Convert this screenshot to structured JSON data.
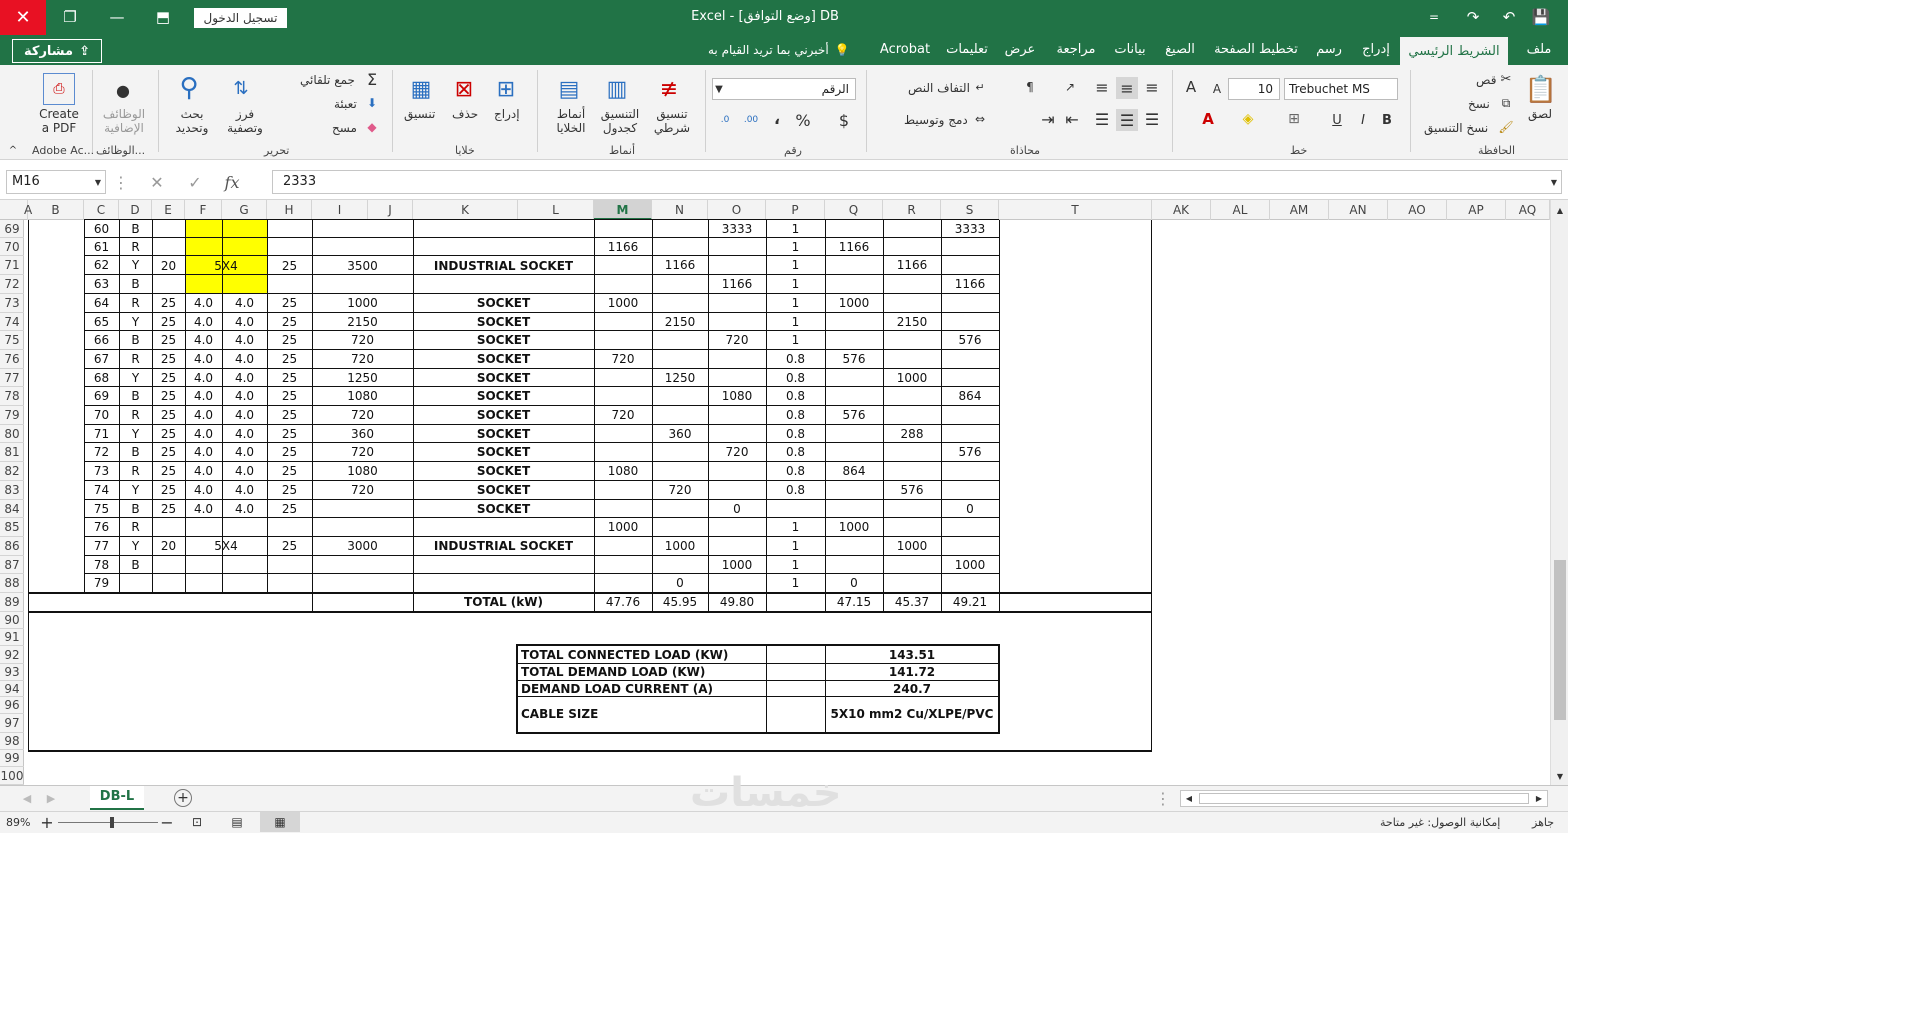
{
  "titlebar": {
    "app_name": "Excel",
    "title": "Excel  -  [وضع التوافق]  DB",
    "login_label": "تسجيل الدخول",
    "qat_dropdown": "="
  },
  "tabs": [
    "ملف",
    "الشريط الرئيسي",
    "إدراج",
    "رسم",
    "تخطيط الصفحة",
    "الصيغ",
    "بيانات",
    "مراجعة",
    "عرض",
    "تعليمات",
    "Acrobat"
  ],
  "tellme": "أخبرني بما تريد القيام به",
  "share_label": "مشاركة",
  "ribbon": {
    "clipboard": {
      "paste": "لصق",
      "cut": "قص",
      "copy": "نسخ",
      "format_painter": "نسخ التنسيق",
      "group": "الحافظة"
    },
    "font": {
      "name": "Trebuchet MS",
      "size": "10",
      "bold": "B",
      "italic": "I",
      "underline": "U",
      "group": "خط"
    },
    "alignment": {
      "wrap": "التفاف النص",
      "merge": "دمج وتوسيط",
      "group": "محاذاة"
    },
    "number": {
      "format": "الرقم",
      "currency": "$",
      "percent": "%",
      "comma": "،",
      "group": "رقم"
    },
    "styles": {
      "conditional": "تنسيق شرطي",
      "as_table": "التنسيق كجدول",
      "cell_styles": "أنماط الخلايا",
      "group": "أنماط"
    },
    "cells": {
      "insert": "إدراج",
      "delete": "حذف",
      "format": "تنسيق",
      "group": "خلايا"
    },
    "editing": {
      "autosum": "جمع تلقائي",
      "fill": "تعبئة",
      "clear": "مسح",
      "sort": "فرز وتصفية",
      "find": "بحث وتحديد",
      "group": "تحرير"
    },
    "addins": {
      "label": "الوظائف الإضافية",
      "group": "الوظائف..."
    },
    "adobe": {
      "create_pdf": "Create a PDF",
      "group": "Adobe Ac..."
    }
  },
  "formula_bar": {
    "name_box": "M16",
    "fx": "fx",
    "value": "2333"
  },
  "columns": [
    "A",
    "B",
    "C",
    "D",
    "E",
    "F",
    "G",
    "H",
    "I",
    "J",
    "K",
    "L",
    "M",
    "N",
    "O",
    "P",
    "Q",
    "R",
    "S",
    "T",
    "AK",
    "AL",
    "AM",
    "AN",
    "AO",
    "AP",
    "AQ"
  ],
  "selected_column": "M",
  "row_numbers": [
    "69",
    "70",
    "71",
    "72",
    "73",
    "74",
    "75",
    "76",
    "77",
    "78",
    "79",
    "80",
    "81",
    "82",
    "83",
    "84",
    "85",
    "86",
    "87",
    "88",
    "89",
    "90",
    "91",
    "92",
    "93",
    "94",
    "96",
    "97",
    "98",
    "99",
    "100"
  ],
  "rows": [
    {
      "c": "60",
      "d": "B",
      "o": "3333",
      "p": "1",
      "s": "3333"
    },
    {
      "c": "61",
      "d": "R",
      "m": "1166",
      "p": "1",
      "q": "1166"
    },
    {
      "c": "62",
      "d": "Y",
      "n": "1166",
      "p": "1",
      "r": "1166"
    },
    {
      "c": "63",
      "d": "B",
      "o": "1166",
      "p": "1",
      "s": "1166"
    },
    {
      "c": "64",
      "d": "R",
      "e": "25",
      "f": "4.0",
      "g": "4.0",
      "h": "25",
      "i": "1000",
      "k": "SOCKET",
      "m": "1000",
      "p": "1",
      "q": "1000"
    },
    {
      "c": "65",
      "d": "Y",
      "e": "25",
      "f": "4.0",
      "g": "4.0",
      "h": "25",
      "i": "2150",
      "k": "SOCKET",
      "n": "2150",
      "p": "1",
      "r": "2150"
    },
    {
      "c": "66",
      "d": "B",
      "e": "25",
      "f": "4.0",
      "g": "4.0",
      "h": "25",
      "i": "720",
      "k": "SOCKET",
      "o": "720",
      "p": "1",
      "s": "576"
    },
    {
      "c": "67",
      "d": "R",
      "e": "25",
      "f": "4.0",
      "g": "4.0",
      "h": "25",
      "i": "720",
      "k": "SOCKET",
      "m": "720",
      "p": "0.8",
      "q": "576"
    },
    {
      "c": "68",
      "d": "Y",
      "e": "25",
      "f": "4.0",
      "g": "4.0",
      "h": "25",
      "i": "1250",
      "k": "SOCKET",
      "n": "1250",
      "p": "0.8",
      "r": "1000"
    },
    {
      "c": "69",
      "d": "B",
      "e": "25",
      "f": "4.0",
      "g": "4.0",
      "h": "25",
      "i": "1080",
      "k": "SOCKET",
      "o": "1080",
      "p": "0.8",
      "s": "864"
    },
    {
      "c": "70",
      "d": "R",
      "e": "25",
      "f": "4.0",
      "g": "4.0",
      "h": "25",
      "i": "720",
      "k": "SOCKET",
      "m": "720",
      "p": "0.8",
      "q": "576"
    },
    {
      "c": "71",
      "d": "Y",
      "e": "25",
      "f": "4.0",
      "g": "4.0",
      "h": "25",
      "i": "360",
      "k": "SOCKET",
      "n": "360",
      "p": "0.8",
      "r": "288"
    },
    {
      "c": "72",
      "d": "B",
      "e": "25",
      "f": "4.0",
      "g": "4.0",
      "h": "25",
      "i": "720",
      "k": "SOCKET",
      "o": "720",
      "p": "0.8",
      "s": "576"
    },
    {
      "c": "73",
      "d": "R",
      "e": "25",
      "f": "4.0",
      "g": "4.0",
      "h": "25",
      "i": "1080",
      "k": "SOCKET",
      "m": "1080",
      "p": "0.8",
      "q": "864"
    },
    {
      "c": "74",
      "d": "Y",
      "e": "25",
      "f": "4.0",
      "g": "4.0",
      "h": "25",
      "i": "720",
      "k": "SOCKET",
      "n": "720",
      "p": "0.8",
      "r": "576"
    },
    {
      "c": "75",
      "d": "B",
      "e": "25",
      "f": "4.0",
      "g": "4.0",
      "h": "25",
      "k": "SOCKET",
      "o": "0",
      "s": "0"
    },
    {
      "c": "76",
      "d": "R",
      "m": "1000",
      "p": "1",
      "q": "1000"
    },
    {
      "c": "77",
      "d": "Y",
      "n": "1000",
      "p": "1",
      "r": "1000"
    },
    {
      "c": "78",
      "d": "B",
      "o": "1000",
      "p": "1",
      "s": "1000"
    },
    {
      "c": "79",
      "n": "0",
      "p": "1",
      "q": "0"
    }
  ],
  "merged": {
    "block1": {
      "e": "20",
      "fg": "5X4",
      "h": "25",
      "i": "3500",
      "k": "INDUSTRIAL SOCKET"
    },
    "block2": {
      "e": "20",
      "fg": "5X4",
      "h": "25",
      "i": "3000",
      "k": "INDUSTRIAL SOCKET"
    }
  },
  "total_row": {
    "label": "TOTAL (kW)",
    "m": "47.76",
    "n": "45.95",
    "o": "49.80",
    "q": "47.15",
    "r": "45.37",
    "s": "49.21"
  },
  "summary": [
    {
      "label": "TOTAL CONNECTED LOAD (KW)",
      "value": "143.51"
    },
    {
      "label": "TOTAL DEMAND LOAD (KW)",
      "value": "141.72"
    },
    {
      "label": "DEMAND LOAD CURRENT (A)",
      "value": "240.7"
    },
    {
      "label": "CABLE SIZE",
      "value": "5X10 mm2 Cu/XLPE/PVC"
    }
  ],
  "sheet_tab": "DB-L",
  "status": {
    "ready": "جاهز",
    "accessibility": "إمكانية الوصول: غير متاحة",
    "zoom": "89%"
  },
  "watermark": "خمسات",
  "colors": {
    "brand": "#217346",
    "close": "#e81123",
    "highlight": "#ffff00"
  }
}
